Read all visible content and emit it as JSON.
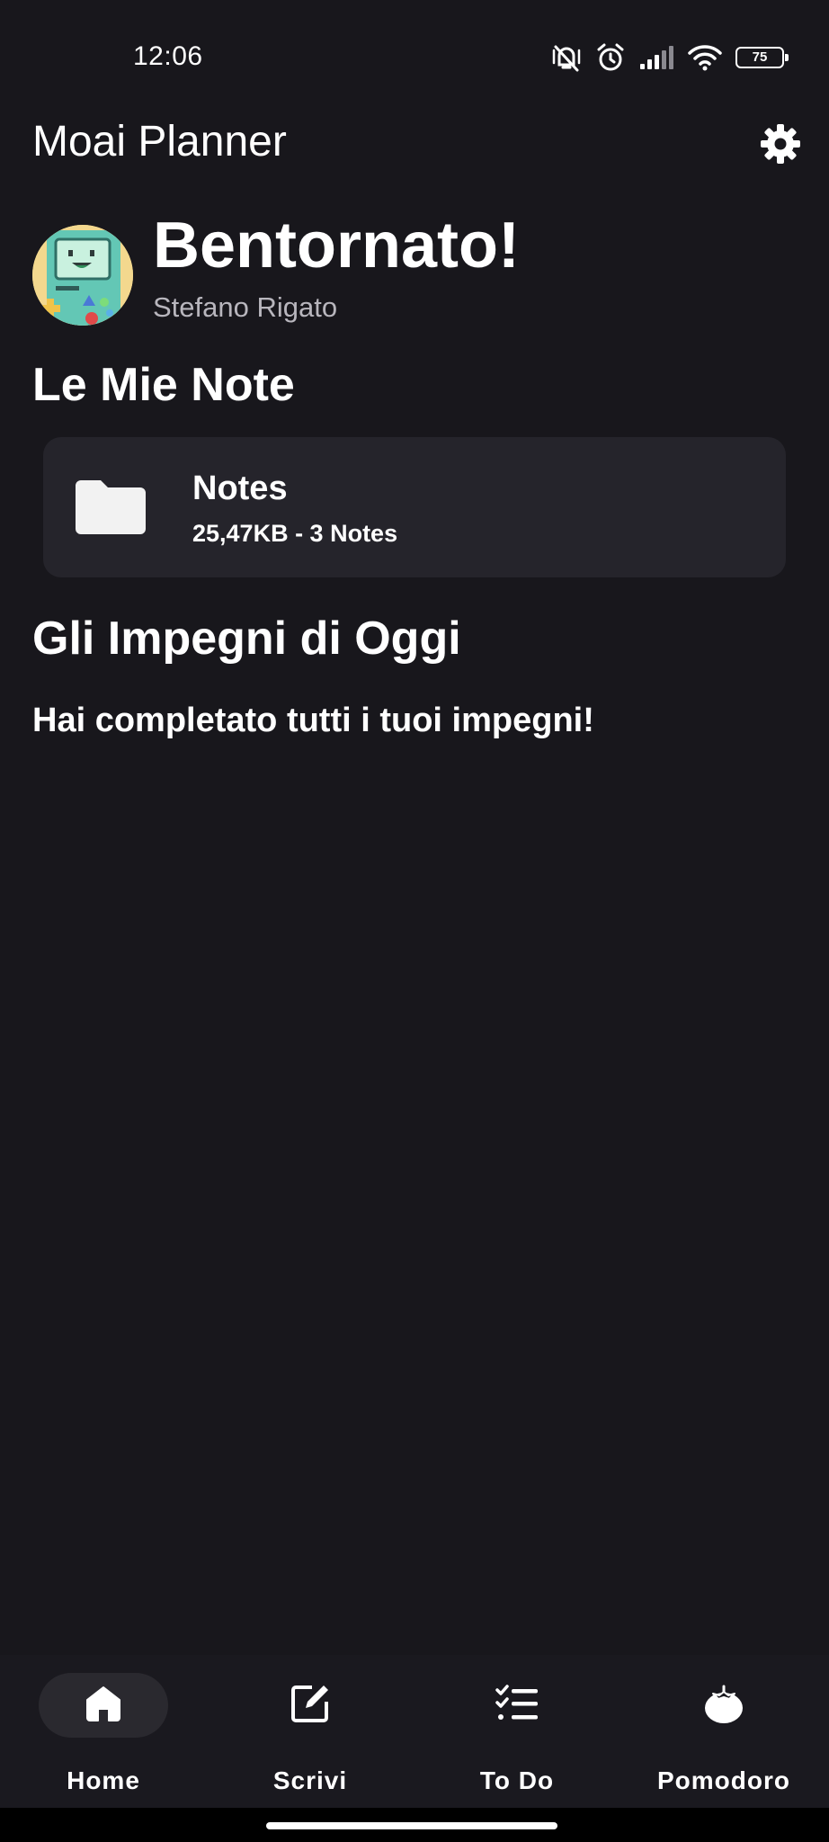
{
  "status_bar": {
    "time": "12:06",
    "battery_level": "75",
    "icons": [
      "vibrate-mute-icon",
      "alarm-icon",
      "signal-icon",
      "wifi-icon",
      "battery-icon"
    ]
  },
  "app_bar": {
    "title": "Moai Planner",
    "settings_icon": "gear-icon"
  },
  "welcome": {
    "title": "Bentornato!",
    "user_name": "Stefano Rigato"
  },
  "notes_section": {
    "title": "Le Mie Note",
    "folders": [
      {
        "name": "Notes",
        "meta": "25,47KB - 3 Notes",
        "icon": "folder-icon"
      }
    ]
  },
  "tasks_section": {
    "title": "Gli Impegni di Oggi",
    "empty_message": "Hai completato tutti i tuoi impegni!"
  },
  "bottom_nav": {
    "items": [
      {
        "label": "Home",
        "icon": "home-icon",
        "active": true
      },
      {
        "label": "Scrivi",
        "icon": "edit-icon",
        "active": false
      },
      {
        "label": "To Do",
        "icon": "checklist-icon",
        "active": false
      },
      {
        "label": "Pomodoro",
        "icon": "tomato-icon",
        "active": false
      }
    ]
  },
  "colors": {
    "background": "#18171c",
    "card": "#25242b",
    "nav_active_pill": "#2a292f",
    "text_primary": "#ffffff",
    "text_secondary": "#b8b6bd"
  }
}
